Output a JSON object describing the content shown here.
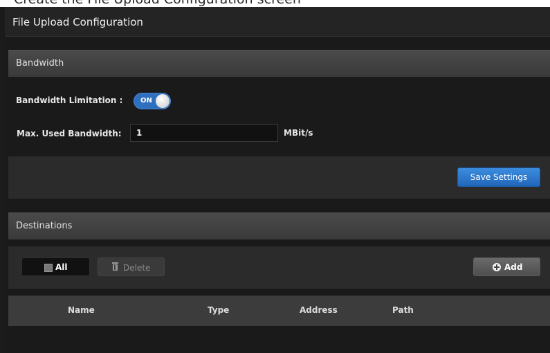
{
  "window": {
    "title_fragment": "Create the File Upload Configuration screen"
  },
  "page": {
    "title": "File Upload Configuration"
  },
  "bandwidth": {
    "section_title": "Bandwidth",
    "limitation_label": "Bandwidth Limitation :",
    "limitation_state": "ON",
    "max_label": "Max. Used Bandwidth:",
    "max_value": "1",
    "unit": "MBit/s",
    "save_label": "Save Settings"
  },
  "destinations": {
    "section_title": "Destinations",
    "select_all_label": "All",
    "delete_label": "Delete",
    "add_label": "Add",
    "columns": [
      "Name",
      "Type",
      "Address",
      "Path"
    ]
  },
  "colors": {
    "accent": "#2f6fbf",
    "background": "#1b1b1b"
  }
}
